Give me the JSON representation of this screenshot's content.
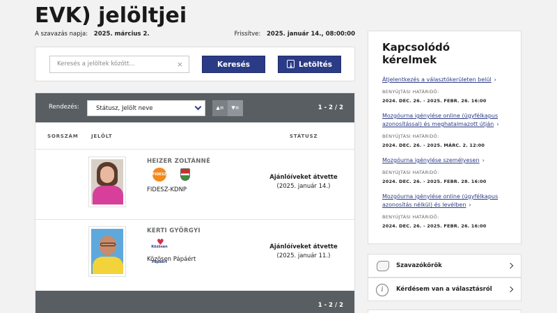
{
  "page": {
    "title_line1": "...",
    "title_line2": "EVK) jelöltjei"
  },
  "meta": {
    "vote_date_label": "A szavazás napja:",
    "vote_date": "2025. március 2.",
    "updated_label": "Frissítve:",
    "updated": "2025. január 14., 08:00:00"
  },
  "search": {
    "placeholder": "Keresés a jelöltek között...",
    "clear_glyph": "×",
    "search_label": "Keresés",
    "download_label": "Letöltés"
  },
  "table": {
    "sort_label": "Rendezés:",
    "sort_value": "Státusz, Jelölt neve",
    "sort_asc_glyph": "▲≡",
    "sort_desc_glyph": "▼≡",
    "pager": "1 - 2 / 2",
    "columns": {
      "number": "SORSZÁM",
      "candidate": "JELÖLT",
      "status": "STÁTUSZ"
    },
    "rows": [
      {
        "name": "HEIZER ZOLTÁNNÉ",
        "party": "FIDESZ-KDNP",
        "logo_text": "FIDESZ",
        "status": "Ajánlóíveket átvette",
        "status_date": "(2025. január 14.)"
      },
      {
        "name": "KERTI GYÖRGYI",
        "party": "Közösen Pápáért",
        "logo_text": "Közösen Pápáért",
        "status": "Ajánlóíveket átvette",
        "status_date": "(2025. január 11.)"
      }
    ],
    "footer_pager": "1 - 2 / 2"
  },
  "related": {
    "title": "Kapcsolódó kérelmek",
    "deadline_label": "BENYÚJTÁSI HATÁRIDŐ:",
    "items": [
      {
        "link": "Átjelentkezés a választókerületen belül",
        "deadline": "2024. DEC. 26. - 2025. FEBR. 26. 16:00"
      },
      {
        "link": "Mozgóurna igénylése online (ügyfélkapus azonosítással) és meghatalmazott útján",
        "deadline": "2024. DEC. 26. - 2025. MÁRC. 2. 12:00"
      },
      {
        "link": "Mozgóurna igénylése személyesen",
        "deadline": "2024. DEC. 26. - 2025. FEBR. 28. 16:00"
      },
      {
        "link": "Mozgóurna igénylése online (ügyfélkapus azonosítás nélkül) és levélben",
        "deadline": "2024. DEC. 26. - 2025. FEBR. 26. 16:00"
      }
    ]
  },
  "side_links": {
    "districts": "Szavazókörök",
    "question": "Kérdésem van a választásról"
  },
  "icons": {
    "search_clear": "close-icon",
    "download": "download-icon",
    "map": "map-icon",
    "info": "info-icon"
  },
  "colors": {
    "primary": "#2b3b86",
    "bar": "#585e62",
    "fidesz": "#f28a1e"
  }
}
